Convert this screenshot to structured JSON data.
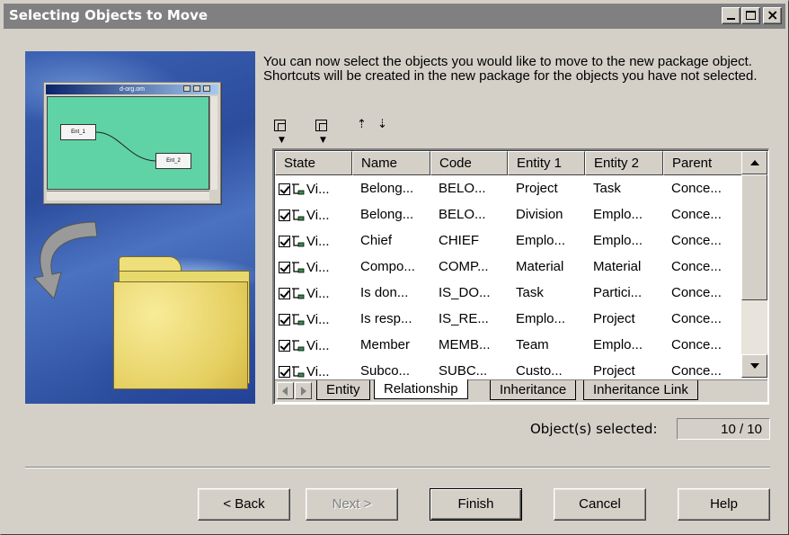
{
  "window": {
    "title": "Selecting Objects to Move"
  },
  "illustration": {
    "mini_window_title": "d-org.om",
    "entity_1": "Ent_1",
    "entity_2": "Ent_2"
  },
  "intro_text": "You can now select the objects you would like to move to the new package object. Shortcuts will be created in the new package for the objects you have not selected.",
  "toolbar": {
    "items": [
      {
        "icon": "select-all-icon",
        "has_dropdown": true
      },
      {
        "icon": "deselect-all-icon",
        "has_dropdown": true
      },
      {
        "icon": "sort-ascending-icon",
        "has_dropdown": false
      },
      {
        "icon": "sort-descending-icon",
        "has_dropdown": false
      }
    ]
  },
  "grid": {
    "columns": [
      "State",
      "Name",
      "Code",
      "Entity 1",
      "Entity 2",
      "Parent"
    ],
    "rows": [
      {
        "state": "Vi...",
        "name": "Belong...",
        "code": "BELO...",
        "entity1": "Project",
        "entity2": "Task",
        "parent": "Conce..."
      },
      {
        "state": "Vi...",
        "name": "Belong...",
        "code": "BELO...",
        "entity1": "Division",
        "entity2": "Emplo...",
        "parent": "Conce..."
      },
      {
        "state": "Vi...",
        "name": "Chief",
        "code": "CHIEF",
        "entity1": "Emplo...",
        "entity2": "Emplo...",
        "parent": "Conce..."
      },
      {
        "state": "Vi...",
        "name": "Compo...",
        "code": "COMP...",
        "entity1": "Material",
        "entity2": "Material",
        "parent": "Conce..."
      },
      {
        "state": "Vi...",
        "name": "Is don...",
        "code": "IS_DO...",
        "entity1": "Task",
        "entity2": "Partici...",
        "parent": "Conce..."
      },
      {
        "state": "Vi...",
        "name": "Is resp...",
        "code": "IS_RE...",
        "entity1": "Emplo...",
        "entity2": "Project",
        "parent": "Conce..."
      },
      {
        "state": "Vi...",
        "name": "Member",
        "code": "MEMB...",
        "entity1": "Team",
        "entity2": "Emplo...",
        "parent": "Conce..."
      },
      {
        "state": "Vi...",
        "name": "Subco...",
        "code": "SUBC...",
        "entity1": "Custo...",
        "entity2": "Project",
        "parent": "Conce..."
      }
    ],
    "tabs": [
      "Entity",
      "Relationship",
      "Inheritance",
      "Inheritance Link"
    ],
    "active_tab": "Relationship"
  },
  "selection": {
    "label": "Object(s) selected:",
    "value": "10 / 10"
  },
  "buttons": {
    "back": "< Back",
    "next": "Next >",
    "finish": "Finish",
    "cancel": "Cancel",
    "help": "Help"
  },
  "colors": {
    "dialog_bg": "#d4d0c8",
    "titlebar_bg": "#808080",
    "illustration_blue": "#2c4c9c",
    "mini_canvas_green": "#5fd3a6",
    "folder_yellow": "#f0e080"
  }
}
